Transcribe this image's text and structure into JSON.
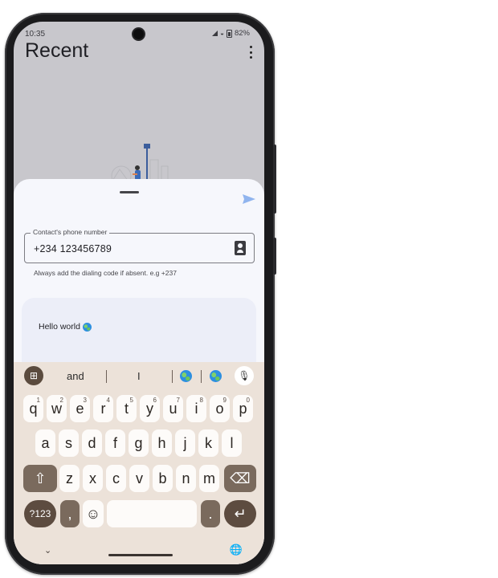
{
  "status": {
    "time": "10:35",
    "battery": "82%"
  },
  "app": {
    "title": "Recent"
  },
  "sheet": {
    "field_label": "Contact's phone number",
    "field_value": "+234 123456789",
    "helper": "Always add the dialing code if absent. e.g +237",
    "message": "Hello world"
  },
  "keyboard": {
    "suggestions": [
      "and",
      "I"
    ],
    "row1": [
      {
        "k": "q",
        "s": "1"
      },
      {
        "k": "w",
        "s": "2"
      },
      {
        "k": "e",
        "s": "3"
      },
      {
        "k": "r",
        "s": "4"
      },
      {
        "k": "t",
        "s": "5"
      },
      {
        "k": "y",
        "s": "6"
      },
      {
        "k": "u",
        "s": "7"
      },
      {
        "k": "i",
        "s": "8"
      },
      {
        "k": "o",
        "s": "9"
      },
      {
        "k": "p",
        "s": "0"
      }
    ],
    "row2": [
      "a",
      "s",
      "d",
      "f",
      "g",
      "h",
      "j",
      "k",
      "l"
    ],
    "row3": [
      "z",
      "x",
      "c",
      "v",
      "b",
      "n",
      "m"
    ],
    "symbols_label": "?123",
    "comma": ",",
    "period": "."
  },
  "icons": [
    "signal-icon",
    "wifi-icon",
    "battery-icon",
    "overflow-icon",
    "send-icon",
    "contacts-icon",
    "globe-emoji-icon",
    "apps-icon",
    "mic-icon",
    "shift-icon",
    "backspace-icon",
    "emoji-icon",
    "enter-icon",
    "chevron-down-icon",
    "language-globe-icon"
  ],
  "colors": {
    "accent_send": "#90b4ee",
    "keyboard_bg": "#ece2d9",
    "key_dark": "#7a6a5d"
  }
}
